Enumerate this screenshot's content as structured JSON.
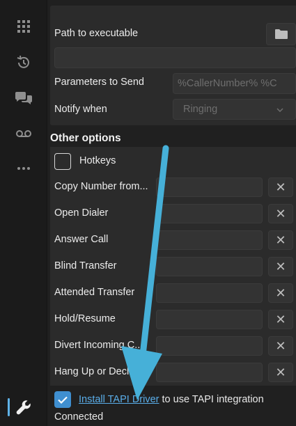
{
  "sidebar": {
    "items": [
      {
        "icon": "apps-grid-icon"
      },
      {
        "icon": "history-icon"
      },
      {
        "icon": "chat-icon"
      },
      {
        "icon": "voicemail-icon"
      },
      {
        "icon": "more-icon"
      },
      {
        "icon": "wrench-icon",
        "active": true
      }
    ],
    "accent": "#5fb3e8"
  },
  "settings": {
    "path_label": "Path to executable",
    "path_value": "",
    "params_label": "Parameters to Send",
    "params_value": "%CallerNumber% %C",
    "notify_label": "Notify when",
    "notify_value": "Ringing"
  },
  "other_options": {
    "heading": "Other options",
    "hotkeys_label": "Hotkeys",
    "hotkeys_checked": false,
    "rows": [
      {
        "label": "Copy Number from..."
      },
      {
        "label": "Open Dialer"
      },
      {
        "label": "Answer Call"
      },
      {
        "label": "Blind Transfer"
      },
      {
        "label": "Attended Transfer"
      },
      {
        "label": "Hold/Resume"
      },
      {
        "label": "Divert Incoming C..."
      },
      {
        "label": "Hang Up or Decli..."
      }
    ],
    "clear_glyph": "✕"
  },
  "tapi": {
    "checked": true,
    "link": "Install TAPI Driver",
    "suffix": " to use TAPI integration",
    "status": "Connected"
  },
  "colors": {
    "background": "#202020",
    "panel": "#2b2b2b",
    "field": "#333333",
    "link": "#5aaeea",
    "annotation_arrow": "#46b0d8"
  }
}
